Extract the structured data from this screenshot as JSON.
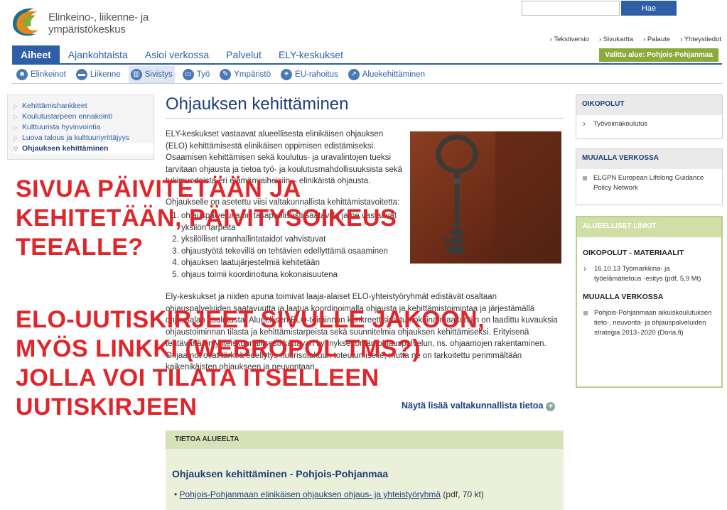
{
  "header": {
    "logo_text": "Elinkeino-, liikenne- ja ympäristökeskus",
    "search_placeholder": "",
    "search_button": "Hae",
    "util_links": [
      "Tekstiversio",
      "Sivukartta",
      "Palaute",
      "Yhteystiedot"
    ]
  },
  "mainnav": {
    "tabs": [
      "Aiheet",
      "Ajankohtaista",
      "Asioi verkossa",
      "Palvelut",
      "ELY-keskukset"
    ],
    "active_tab": "Aiheet",
    "region_label": "Valittu alue: Pohjois-Pohjanmaa"
  },
  "subnav": {
    "items": [
      "Elinkeinot",
      "Liikenne",
      "Sivistys",
      "Työ",
      "Ympäristö",
      "EU-rahoitus",
      "Aluekehittäminen"
    ],
    "active": "Sivistys"
  },
  "leftnav": {
    "items": [
      "Kehittämishankkeet",
      "Koulutustarpeen ennakointi",
      "Kulttuurista hyvinvointia",
      "Luova talous ja kulttuuriyrittäjyys",
      "Ohjauksen kehittäminen"
    ]
  },
  "main": {
    "title": "Ohjauksen kehittäminen",
    "p1": "ELY-keskukset vastaavat alueellisesta elinikäisen ohjauksen (ELO) kehittämisestä elinikäisen oppimisen edistämiseksi. Osaamisen kehittämisen sekä koulutus- ja uravalintojen tueksi tarvitaan ohjausta ja tietoa työ- ja koulutusmahdollisuuksista sekä tukimuodoista eri elämänvaiheisiin – elinikäistä ohjausta.",
    "p2": "Ohjaukselle on asetettu viisi valtakunnallista kehittämistavoitetta:",
    "goals": [
      "ohjauspalveluita on tasapuolisesti saatavilla ja ne vastaavat yksilön tarpeita",
      "yksilölliset uranhallintataidot vahvistuvat",
      "ohjaustyötä tekevillä on tehtävien edellyttämä osaaminen",
      "ohjauksen laatujärjestelmiä kehitetään",
      "ohjaus toimii koordinoituna kokonaisuutena"
    ],
    "p3": "Ely-keskukset ja niiden apuna toimivat laaja-alaiset ELO-yhteistyöryhmät edistävät osaltaan ohjauspalveluiden saatavuutta ja laatua koordinoimalla ohjausta ja kehittämistoimintaa ja järjestämällä ohjausalan koulutusta. Alueellisen ELO-toiminnan konkreettisina tuotoksina maakuntiin on laadittu kuvauksia ohjaustoiminnan tilasta ja kehittämistarpeista sekä suunnitelmia ohjauksen kehittämiseksi. Erityisenä tehtävänä on yhteiskunnallisesti kattavan kynnyksettömän ohjauspalvelun, ns. ohjaamojen rakentaminen. Ohjaamot ovat tärkeä edellytys nuorisotakuun toteutumiselle, mutta ne on tarkoitettu perimmältään kaikenikäisten ohjaukseen ja neuvontaan.",
    "more_link": "Näytä lisää valtakunnallista tietoa"
  },
  "region_box": {
    "header": "TIETOA ALUEELTA",
    "title": "Ohjauksen kehittäminen - Pohjois-Pohjanmaa",
    "link_text": "Pohjois-Pohjanmaan elinikäisen ohjauksen ohjaus- ja yhteistyöryhmä",
    "link_meta": " (pdf, 70 kt)"
  },
  "right": {
    "box1_header": "OIKOPOLUT",
    "box1_item": "Työvoimakoulutus",
    "box2_header": "MUUALLA VERKOSSA",
    "box2_item": "ELGPN European Lifelong Guidance Policy Network",
    "box3_header": "ALUEELLISET LINKIT",
    "box3_sub1": "OIKOPOLUT - MATERIAALIT",
    "box3_item1": "16.10.13 Työmarkkina- ja työelämätietous -esitys (pdf, 5,9 Mt)",
    "box3_sub2": "MUUALLA VERKOSSA",
    "box3_item2": "Pohjois-Pohjanmaan aikuiskoulutuksen tieto-, neuvonta- ja ohjauspalveluiden strategia 2013–2020 (Doria.fi)"
  },
  "annotation": {
    "line1": "SIVUA PÄIVITETÄÄN JA",
    "line2": "KEHITETÄÄN, PÄIVITYSOIKEUS",
    "line3": "TEEALLE?",
    "line4": "ELO-UUTISKIRJEET SIVULLE JAKOON,",
    "line5": "MYÖS LINKKI (WEBROPOL TMS?)",
    "line6": "JOLLA VOI TILATA ITSELLEEN",
    "line7": "UUTISKIRJEEN",
    "color": "#e0252b"
  }
}
